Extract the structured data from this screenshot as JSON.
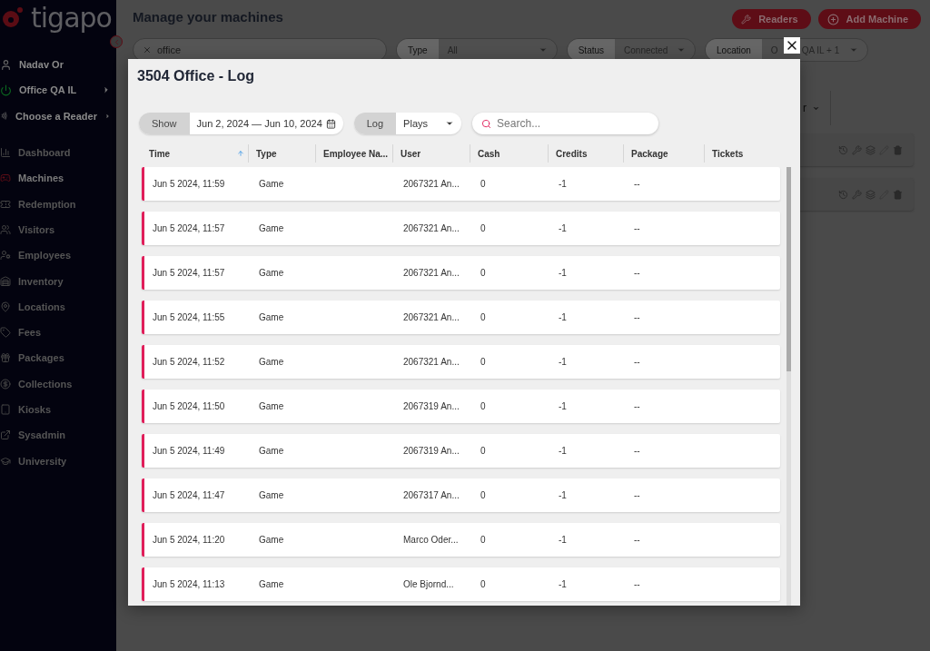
{
  "sidebar": {
    "logo": "tigapo",
    "user": "Nadav Or",
    "context": [
      {
        "label": "Office QA IL",
        "kind": "power"
      },
      {
        "label": "Choose a Reader",
        "kind": "reader"
      }
    ],
    "items": [
      {
        "label": "Dashboard",
        "selected": false
      },
      {
        "label": "Machines",
        "selected": true
      },
      {
        "label": "Redemption",
        "selected": false
      },
      {
        "label": "Visitors",
        "selected": false
      },
      {
        "label": "Employees",
        "selected": false
      },
      {
        "label": "Inventory",
        "selected": false
      },
      {
        "label": "Locations",
        "selected": false
      },
      {
        "label": "Fees",
        "selected": false
      },
      {
        "label": "Packages",
        "selected": false
      },
      {
        "label": "Collections",
        "selected": false
      },
      {
        "label": "Kiosks",
        "selected": false
      },
      {
        "label": "Sysadmin",
        "selected": false
      },
      {
        "label": "University",
        "selected": false
      }
    ]
  },
  "page": {
    "title": "Manage your machines",
    "buttons": [
      "Readers",
      "Add Machine"
    ],
    "search": "office",
    "filters": [
      {
        "label": "Type",
        "value": "All"
      },
      {
        "label": "Status",
        "value": "Connected"
      },
      {
        "label": "Location",
        "value": "O",
        "value_rest": "QA IL + 1"
      }
    ],
    "side_select": "r"
  },
  "dialog": {
    "title": "3504 Office - Log",
    "show_label": "Show",
    "date_range": "Jun 2, 2024 — Jun 10, 2024",
    "log_label": "Log",
    "log_value": "Plays",
    "search_placeholder": "Search...",
    "columns": [
      {
        "label": "Time",
        "sorted": true
      },
      {
        "label": "Type",
        "sorted": false
      },
      {
        "label": "Employee Na...",
        "sorted": false
      },
      {
        "label": "User",
        "sorted": false
      },
      {
        "label": "Cash",
        "sorted": false
      },
      {
        "label": "Credits",
        "sorted": false
      },
      {
        "label": "Package",
        "sorted": false
      },
      {
        "label": "Tickets",
        "sorted": false
      }
    ],
    "rows": [
      {
        "time": "Jun 5 2024, 11:59",
        "type": "Game",
        "user": "2067321 An...",
        "cash": "0",
        "credits": "-1",
        "package": "--"
      },
      {
        "time": "Jun 5 2024, 11:57",
        "type": "Game",
        "user": "2067321 An...",
        "cash": "0",
        "credits": "-1",
        "package": "--"
      },
      {
        "time": "Jun 5 2024, 11:57",
        "type": "Game",
        "user": "2067321 An...",
        "cash": "0",
        "credits": "-1",
        "package": "--"
      },
      {
        "time": "Jun 5 2024, 11:55",
        "type": "Game",
        "user": "2067321 An...",
        "cash": "0",
        "credits": "-1",
        "package": "--"
      },
      {
        "time": "Jun 5 2024, 11:52",
        "type": "Game",
        "user": "2067321 An...",
        "cash": "0",
        "credits": "-1",
        "package": "--"
      },
      {
        "time": "Jun 5 2024, 11:50",
        "type": "Game",
        "user": "2067319 An...",
        "cash": "0",
        "credits": "-1",
        "package": "--"
      },
      {
        "time": "Jun 5 2024, 11:49",
        "type": "Game",
        "user": "2067319 An...",
        "cash": "0",
        "credits": "-1",
        "package": "--"
      },
      {
        "time": "Jun 5 2024, 11:47",
        "type": "Game",
        "user": "2067317 An...",
        "cash": "0",
        "credits": "-1",
        "package": "--"
      },
      {
        "time": "Jun 5 2024, 11:20",
        "type": "Game",
        "user": "Marco Oder...",
        "cash": "0",
        "credits": "-1",
        "package": "--"
      },
      {
        "time": "Jun 5 2024, 11:13",
        "type": "Game",
        "user": "Ole Bjornd...",
        "cash": "0",
        "credits": "-1",
        "package": "--"
      }
    ]
  }
}
